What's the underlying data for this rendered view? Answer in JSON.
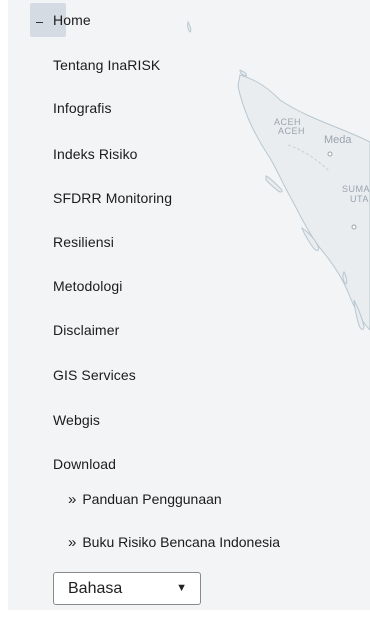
{
  "menu": {
    "items": [
      {
        "label": "Home"
      },
      {
        "label": "Tentang InaRISK"
      },
      {
        "label": "Infografis"
      },
      {
        "label": "Indeks Risiko"
      },
      {
        "label": "SFDRR Monitoring"
      },
      {
        "label": "Resiliensi"
      },
      {
        "label": "Metodologi"
      },
      {
        "label": "Disclaimer"
      },
      {
        "label": "GIS Services"
      },
      {
        "label": "Webgis"
      },
      {
        "label": "Download"
      }
    ],
    "download_subitems": [
      {
        "label": "Panduan Penggunaan"
      },
      {
        "label": "Buku Risiko Bencana Indonesia"
      }
    ]
  },
  "language": {
    "selected": "Bahasa"
  },
  "map": {
    "labels": [
      "ACEH",
      "Meda",
      "SUMA",
      "UTA"
    ]
  }
}
